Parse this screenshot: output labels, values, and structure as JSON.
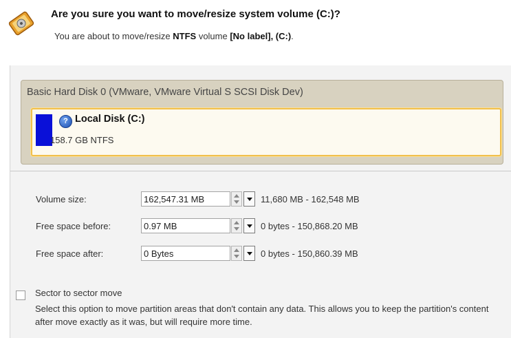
{
  "header": {
    "title": "Are you sure you want to move/resize system volume (C:)?",
    "subtitle_prefix": "You are about to move/resize ",
    "subtitle_fs": "NTFS",
    "subtitle_mid": " volume ",
    "subtitle_label": "[No label], (C:)",
    "subtitle_end": "."
  },
  "disk": {
    "header": "Basic Hard Disk 0 (VMware, VMware Virtual S SCSI Disk Dev)",
    "partition": {
      "name": "Local Disk (C:)",
      "size": "158.7 GB NTFS",
      "bar_color": "#0a10d8"
    }
  },
  "fields": [
    {
      "label": "Volume size:",
      "value": "162,547.31 MB",
      "range": "11,680 MB - 162,548 MB"
    },
    {
      "label": "Free space before:",
      "value": "0.97 MB",
      "range": "0 bytes - 150,868.20 MB"
    },
    {
      "label": "Free space after:",
      "value": "0 Bytes",
      "range": "0 bytes - 150,860.39 MB"
    }
  ],
  "options": {
    "sector_move_label": "Sector to sector move",
    "sector_move_checked": false,
    "sector_move_desc": "Select this option to move partition areas that don't contain any data. This allows you to keep the partition's content after move exactly as it was, but will require more time."
  },
  "colors": {
    "accent_border": "#f2c04c",
    "panel_bg": "#d8d2c0",
    "dialog_bg": "#f3f3f3"
  }
}
